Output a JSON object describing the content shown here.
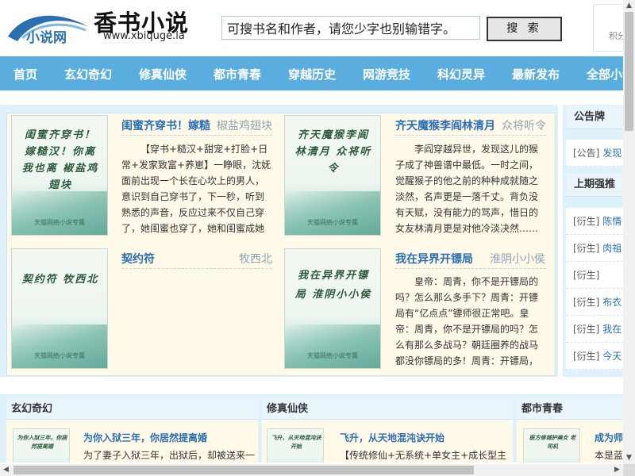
{
  "site": {
    "logo_small": "小说网",
    "title": "香书小说",
    "url": "www.xbiquge.la"
  },
  "search": {
    "value": "可搜书名和作者，请您少字也别输错字。",
    "button": "搜 索"
  },
  "user_box": {
    "text": "积分"
  },
  "nav": [
    "首页",
    "玄幻奇幻",
    "修真仙侠",
    "都市青春",
    "穿越历史",
    "网游竞技",
    "科幻灵异",
    "最新发布",
    "全部小说"
  ],
  "featured": [
    {
      "cover_text": "闺蜜齐穿书！嫁糙汉！你离我也离 椒盐鸡翅块",
      "cover_footer": "天猫网络小说专属",
      "title": "闺蜜齐穿书！嫁糙",
      "author": "椒盐鸡翅块",
      "desc": "【穿书+糙汉+甜宠+打脸+日常+发家致富+养崽】一睁眼，沈妩面前出现一个长在心坎上的男人，意识到自己穿书了，下一秒，听到熟悉的声音，反应过来不仅自己穿了，她闺蜜也穿了，她和闺蜜成她"
    },
    {
      "cover_text": "齐天魔猴李阎林清月 众将听令",
      "cover_footer": "天猫网络小说专属",
      "title": "齐天魔猴李阎林清月",
      "author": "众将听令",
      "desc": "李阎穿越异世，发现这儿的猴子成了神兽谱中最低。一时之间，觉醒猴子的他之前的种种成就随之淡然，名声更是一落千丈。背负没有天赋，没有能力的骂声，惜日的女友林清月更是对他冷淡决然……"
    },
    {
      "cover_text": "契约符 牧西北",
      "cover_footer": "天猫网络小说专属",
      "title": "契约符",
      "author": "牧西北",
      "desc": ""
    },
    {
      "cover_text": "我在异界开镖局 淮阴小小侯",
      "cover_footer": "天猫网络小说专属",
      "title": "我在异界开镖局",
      "author": "淮阴小小侯",
      "desc": "皇帝：周青，你不是开镖局的吗？怎么那么多手下？周青：开镖局有“亿点点”镖师很正常吧。皇帝：周青，你不是开镖局的吗？怎么有那么多战马？朝廷圈养的战马都没你镖局的多！周青：开镖局，"
    }
  ],
  "announcements": {
    "header": "公告牌",
    "items": [
      {
        "tag": "[公告]",
        "text": "发现"
      }
    ],
    "last_header": "上期强推",
    "last_items": [
      {
        "tag": "[衍生]",
        "text": "陈情"
      },
      {
        "tag": "[衍生]",
        "text": "肉祖"
      },
      {
        "tag": "[衍生]",
        "text": ""
      },
      {
        "tag": "[衍生]",
        "text": "布衣"
      },
      {
        "tag": "[衍生]",
        "text": "我在"
      },
      {
        "tag": "[衍生]",
        "text": "今天"
      }
    ]
  },
  "categories": [
    {
      "name": "玄幻奇幻",
      "cover_text": "为你入狱三年，你居然提离婚",
      "book_title": "为你入狱三年，你居然提离婚",
      "book_desc": "为了妻子入狱三年，出狱后，却被送来一"
    },
    {
      "name": "修真仙侠",
      "cover_text": "飞升，从天地混沌诀开始",
      "book_title": "飞升，从天地混沌诀开始",
      "book_desc": "【传统修仙+无系统+单女主+成长型主"
    },
    {
      "name": "都市青春",
      "cover_text": "医方修城护美女 老司机",
      "book_title": "成为师",
      "book_desc": "本是蓝"
    }
  ]
}
